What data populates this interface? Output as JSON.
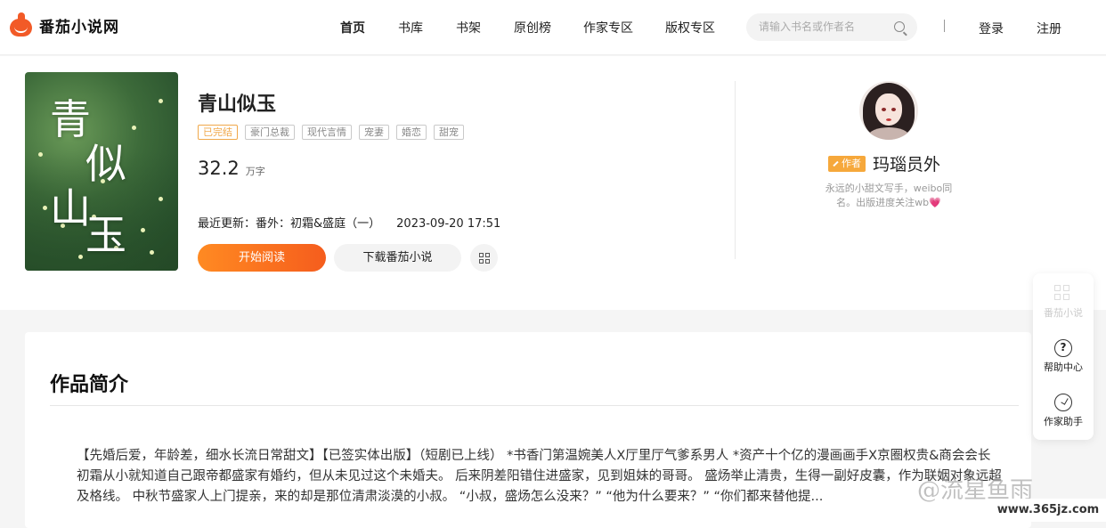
{
  "header": {
    "logo_text": "番茄小说网",
    "nav": [
      {
        "label": "首页",
        "active": true
      },
      {
        "label": "书库",
        "active": false
      },
      {
        "label": "书架",
        "active": false
      },
      {
        "label": "原创榜",
        "active": false
      },
      {
        "label": "作家专区",
        "active": false
      },
      {
        "label": "版权专区",
        "active": false
      }
    ],
    "search_placeholder": "请输入书名或作者名",
    "login_label": "登录",
    "register_label": "注册"
  },
  "book": {
    "cover_title": [
      "青",
      "似",
      "山",
      "玉"
    ],
    "title": "青山似玉",
    "tags": [
      {
        "label": "已完结",
        "status": true
      },
      {
        "label": "豪门总裁",
        "status": false
      },
      {
        "label": "现代言情",
        "status": false
      },
      {
        "label": "宠妻",
        "status": false
      },
      {
        "label": "婚恋",
        "status": false
      },
      {
        "label": "甜宠",
        "status": false
      }
    ],
    "word_count": "32.2",
    "word_unit": "万字",
    "latest_update_prefix": "最近更新：",
    "latest_chapter": "番外：初霜&盛庭（一）",
    "update_time": "2023-09-20 17:51",
    "read_button": "开始阅读",
    "download_button": "下载番茄小说"
  },
  "author": {
    "badge": "作者",
    "name": "玛瑙员外",
    "description": "永远的小甜文写手，weibo同名。出版进度关注wb💗"
  },
  "float_panel": {
    "items": [
      "番茄小说",
      "帮助中心",
      "作家助手"
    ]
  },
  "intro": {
    "title": "作品简介",
    "text": "【先婚后爱，年龄差，细水长流日常甜文】【已签实体出版】（短剧已上线） *书香门第温婉美人X厅里厅气爹系男人 *资产十个亿的漫画画手X京圈权贵&商会会长 初霜从小就知道自己跟帝都盛家有婚约，但从未见过这个未婚夫。 后来阴差阳错住进盛家，见到姐妹的哥哥。 盛炀举止清贵，生得一副好皮囊，作为联姻对象远超及格线。 中秋节盛家人上门提亲，来的却是那位清肃淡漠的小叔。 “小叔，盛炀怎么没来？” “他为什么要来？” “你们都来替他提..."
  },
  "watermark": {
    "text": "@流星鱼雨",
    "url": "www.365jz.com"
  },
  "colors": {
    "accent": "#f55d1d",
    "tag_done": "#f0a84a",
    "author_badge": "#f6a83b"
  }
}
